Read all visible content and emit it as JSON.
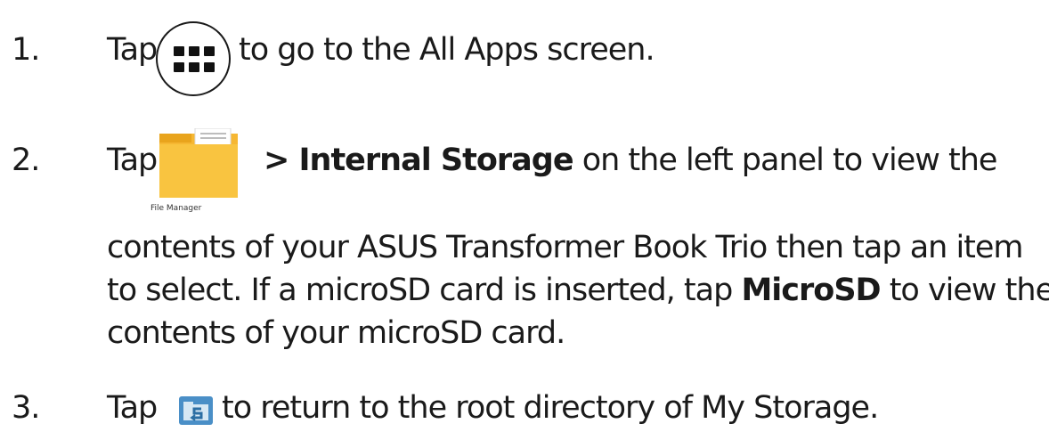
{
  "steps": [
    {
      "number": "1.",
      "before": "Tap",
      "after": "to go to the All Apps screen.",
      "icon": "all-apps-icon"
    },
    {
      "number": "2.",
      "before": "Tap",
      "bold1": "> Internal Storage",
      "after1": " on the left panel to view the",
      "line2": "contents of your ASUS Transformer Book Trio then tap an item",
      "line3_before": "to select. If a microSD card is inserted, tap ",
      "bold2": "MicroSD",
      "line3_after": " to view the",
      "line4": "contents of your microSD card.",
      "icon": "file-manager-icon",
      "icon_label": "File Manager"
    },
    {
      "number": "3.",
      "before": "Tap",
      "after": "to return to the root directory of My Storage.",
      "icon": "return-root-icon"
    }
  ],
  "colors": {
    "text": "#1a1a1a",
    "folder_yellow": "#f6b732",
    "return_icon_blue": "#3a7fb8"
  }
}
